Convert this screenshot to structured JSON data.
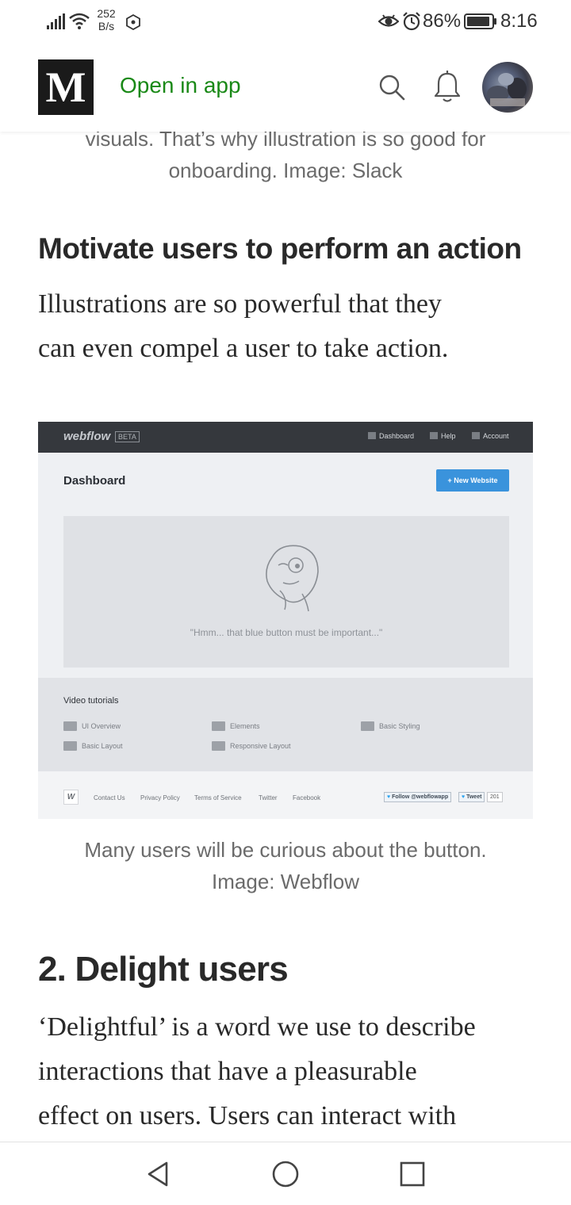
{
  "status_bar": {
    "net_speed_value": "252",
    "net_speed_unit": "B/s",
    "battery": "86%",
    "time": "8:16",
    "icons": [
      "signal-icon",
      "wifi-icon",
      "hexagon-icon",
      "eye-icon",
      "alarm-icon",
      "battery-icon"
    ]
  },
  "header": {
    "logo": "M",
    "open_in_app": "Open in app",
    "icons": [
      "search-icon",
      "bell-icon"
    ],
    "accent_color": "#1a8917"
  },
  "article": {
    "caption_top_line1": "visuals. That’s why illustration is so good for",
    "caption_top_line2": "onboarding. Image: Slack",
    "heading_motivate": "Motivate users to perform an action",
    "para_motivate_line1": "Illustrations are so powerful that they",
    "para_motivate_line2": "can even compel a user to take action.",
    "caption_webflow_line1": "Many users will be curious about the button.",
    "caption_webflow_line2": "Image: Webflow",
    "heading_delight": "2. Delight users",
    "para_delight_line1": "‘Delightful’ is a word we use to describe",
    "para_delight_line2": "interactions that have a pleasurable",
    "para_delight_line3": "effect on users. Users can interact with"
  },
  "webflow_image": {
    "logo": "webflow",
    "beta": "BETA",
    "nav": [
      "Dashboard",
      "Help",
      "Account"
    ],
    "title": "Dashboard",
    "new_website": "+ New Website",
    "quote": "\"Hmm... that blue button must be important...\"",
    "video_title": "Video tutorials",
    "videos": [
      "UI Overview",
      "Elements",
      "Basic Styling",
      "Basic Layout",
      "Responsive Layout"
    ],
    "footer_logo": "W",
    "footer_links": [
      "Contact Us",
      "Privacy Policy",
      "Terms of Service",
      "Twitter",
      "Facebook"
    ],
    "follow": "Follow @webflowapp",
    "tweet": "Tweet",
    "tweet_count": "201",
    "button_color": "#3a93dc"
  },
  "bottom_nav": {
    "icons": [
      "back-icon",
      "home-icon",
      "recent-apps-icon"
    ]
  }
}
